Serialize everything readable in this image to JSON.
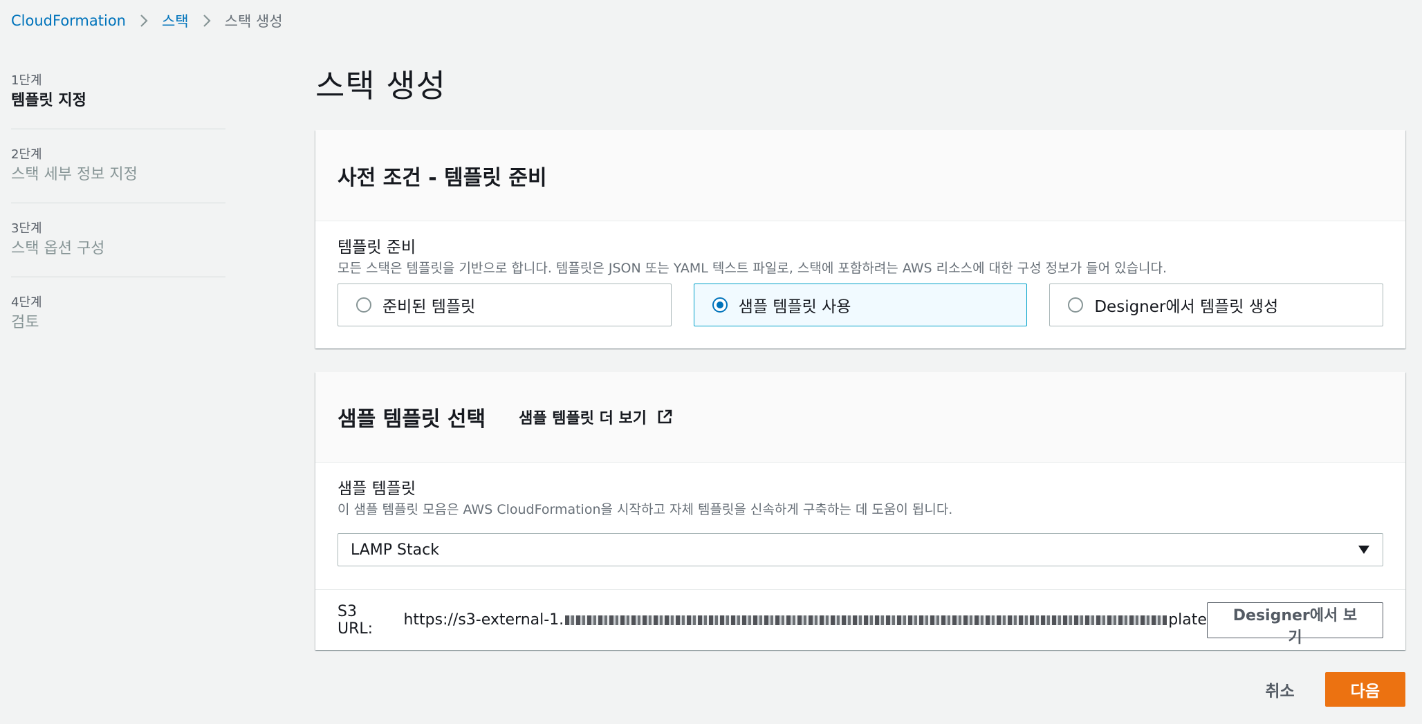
{
  "breadcrumb": {
    "items": [
      "CloudFormation",
      "스택",
      "스택 생성"
    ]
  },
  "steps": [
    {
      "num": "1단계",
      "title": "템플릿 지정"
    },
    {
      "num": "2단계",
      "title": "스택 세부 정보 지정"
    },
    {
      "num": "3단계",
      "title": "스택 옵션 구성"
    },
    {
      "num": "4단계",
      "title": "검토"
    }
  ],
  "page": {
    "title": "스택 생성"
  },
  "prereq": {
    "header": "사전 조건 - 템플릿 준비",
    "field_label": "템플릿 준비",
    "field_desc": "모든 스택은 템플릿을 기반으로 합니다. 템플릿은 JSON 또는 YAML 텍스트 파일로, 스택에 포함하려는 AWS 리소스에 대한 구성 정보가 들어 있습니다.",
    "options": [
      {
        "label": "준비된 템플릿",
        "selected": false
      },
      {
        "label": "샘플 템플릿 사용",
        "selected": true
      },
      {
        "label": "Designer에서 템플릿 생성",
        "selected": false
      }
    ]
  },
  "sample": {
    "header": "샘플 템플릿 선택",
    "more_link": "샘플 템플릿 더 보기",
    "field_label": "샘플 템플릿",
    "field_desc": "이 샘플 템플릿 모음은 AWS CloudFormation을 시작하고 자체 템플릿을 신속하게 구축하는 데 도움이 됩니다.",
    "selected_value": "LAMP Stack",
    "s3_label": "S3 URL:",
    "s3_url_prefix": "https://s3-external-1.",
    "s3_url_suffix": "plate",
    "designer_button": "Designer에서 보기"
  },
  "actions": {
    "cancel": "취소",
    "next": "다음"
  },
  "colors": {
    "primary": "#ec7211",
    "link": "#0073bb",
    "selected_border": "#00a1c9"
  }
}
